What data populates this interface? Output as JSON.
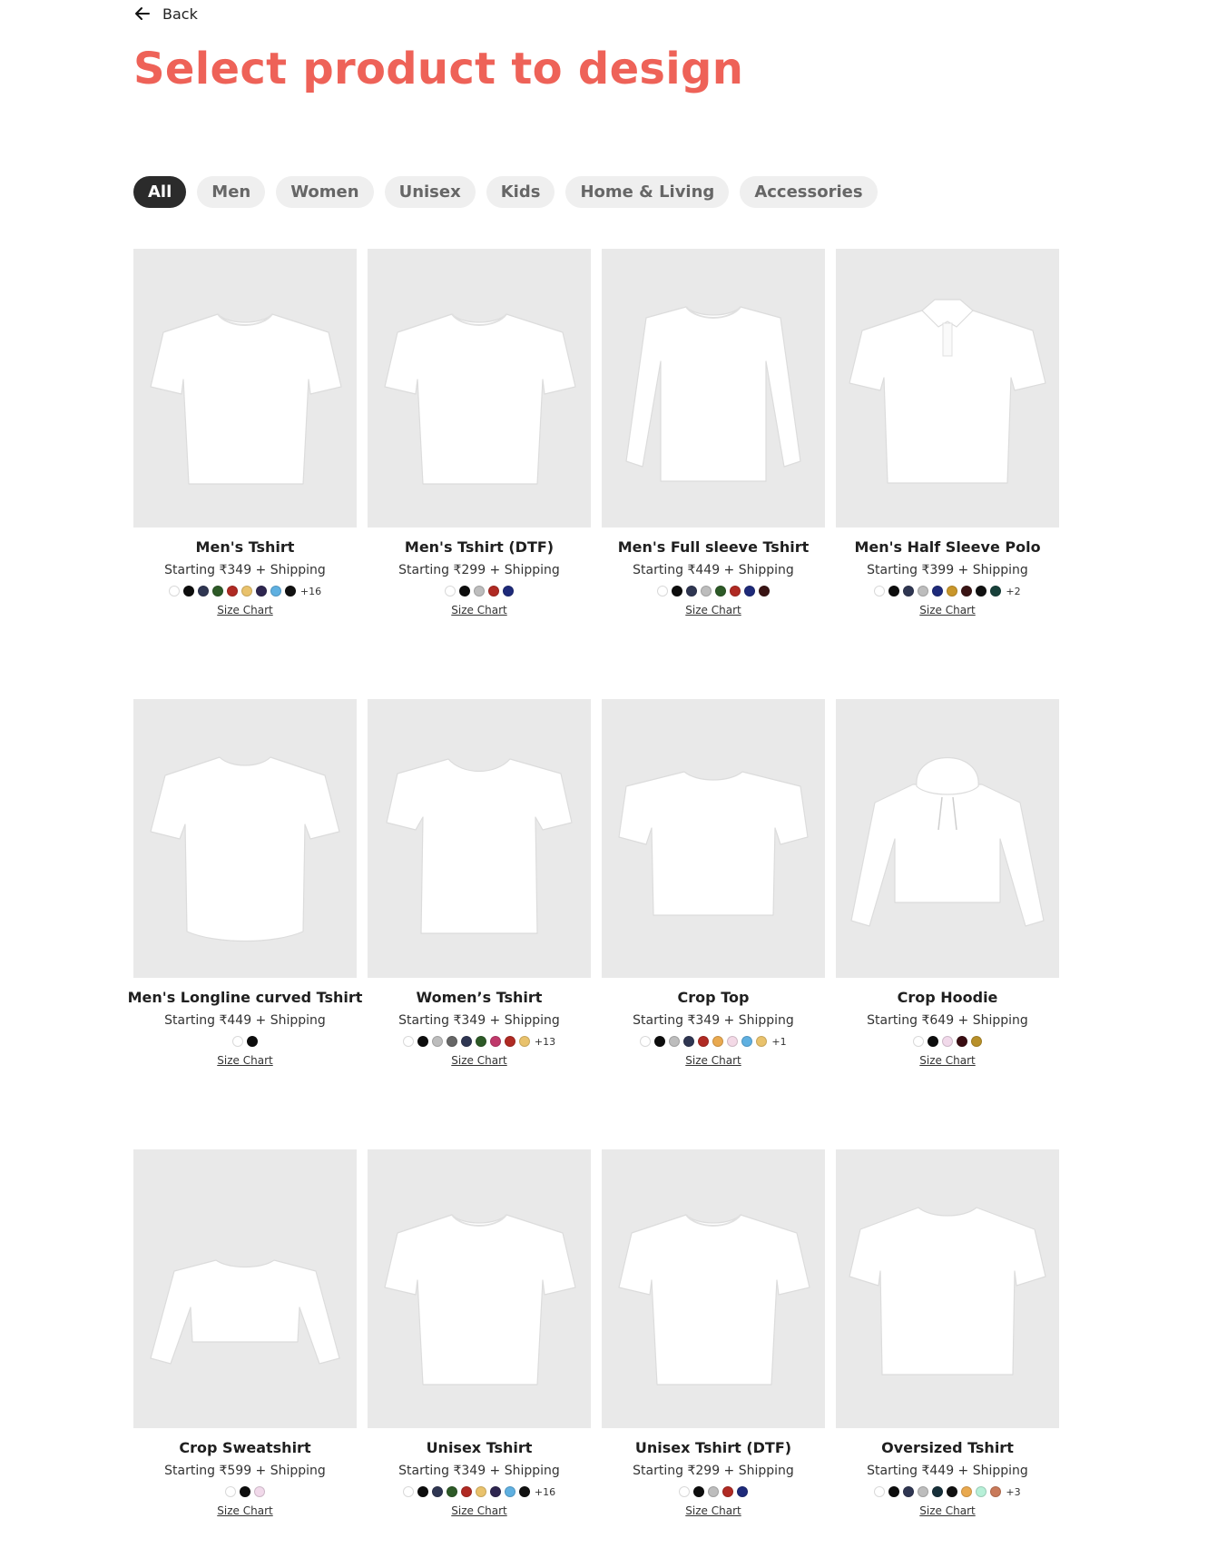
{
  "header": {
    "back_label": "Back",
    "title": "Select product to design"
  },
  "categories": [
    "All",
    "Men",
    "Women",
    "Unisex",
    "Kids",
    "Home & Living",
    "Accessories"
  ],
  "active_category": "All",
  "colors": {
    "title": "#ee6258",
    "chip_active": "#2b2b2b",
    "chip_bg": "#efefef",
    "thumb_bg": "#e9e9e9"
  },
  "products": [
    {
      "name": "Men's Tshirt",
      "price": "Starting ₹349 + Shipping",
      "shape": "tshirt",
      "swatches": [
        "#ffffff",
        "#0d0d0d",
        "#2f3652",
        "#2d5a27",
        "#b02a23",
        "#e9c26c",
        "#2e2650",
        "#5fb0e1",
        "#111111"
      ],
      "more": "+16",
      "size_chart": "Size Chart"
    },
    {
      "name": "Men's Tshirt (DTF)",
      "price": "Starting ₹299 + Shipping",
      "shape": "tshirt",
      "swatches": [
        "#ffffff",
        "#0d0d0d",
        "#bdbdbd",
        "#b02a23",
        "#1e2a7a"
      ],
      "more": "",
      "size_chart": "Size Chart"
    },
    {
      "name": "Men's Full sleeve Tshirt",
      "price": "Starting ₹449 + Shipping",
      "shape": "longsleeve",
      "swatches": [
        "#ffffff",
        "#0d0d0d",
        "#2f3652",
        "#bdbdbd",
        "#2d5a27",
        "#b02a23",
        "#1e2a7a",
        "#3a1414"
      ],
      "more": "",
      "size_chart": "Size Chart"
    },
    {
      "name": "Men's Half Sleeve Polo",
      "price": "Starting ₹399 + Shipping",
      "shape": "polo",
      "swatches": [
        "#ffffff",
        "#0d0d0d",
        "#2f3652",
        "#bdbdbd",
        "#1e2a7a",
        "#c9962a",
        "#3a1414",
        "#111111",
        "#17403a"
      ],
      "more": "+2",
      "size_chart": "Size Chart"
    },
    {
      "name": "Men's Longline curved Tshirt",
      "price": "Starting ₹449 + Shipping",
      "shape": "longline",
      "swatches": [
        "#ffffff",
        "#0d0d0d"
      ],
      "more": "",
      "size_chart": "Size Chart"
    },
    {
      "name": "Women’s Tshirt",
      "price": "Starting ₹349 + Shipping",
      "shape": "womens",
      "swatches": [
        "#ffffff",
        "#0d0d0d",
        "#bdbdbd",
        "#666666",
        "#2f3652",
        "#2d5a27",
        "#c0396b",
        "#b02a23",
        "#e9c26c"
      ],
      "more": "+13",
      "size_chart": "Size Chart"
    },
    {
      "name": "Crop Top",
      "price": "Starting ₹349 + Shipping",
      "shape": "croptop",
      "swatches": [
        "#ffffff",
        "#0d0d0d",
        "#bdbdbd",
        "#2f3652",
        "#b02a23",
        "#e9a94f",
        "#f3d9e6",
        "#5fb0e1",
        "#e9c26c"
      ],
      "more": "+1",
      "size_chart": "Size Chart"
    },
    {
      "name": "Crop Hoodie",
      "price": "Starting ₹649 + Shipping",
      "shape": "hoodie",
      "swatches": [
        "#ffffff",
        "#0d0d0d",
        "#f1d9ea",
        "#3a0d12",
        "#b8902a"
      ],
      "more": "",
      "size_chart": "Size Chart"
    },
    {
      "name": "Crop Sweatshirt",
      "price": "Starting ₹599 + Shipping",
      "shape": "sweatshirt",
      "swatches": [
        "#ffffff",
        "#0d0d0d",
        "#f1d9ea"
      ],
      "more": "",
      "size_chart": "Size Chart"
    },
    {
      "name": "Unisex Tshirt",
      "price": "Starting ₹349 + Shipping",
      "shape": "tshirt",
      "swatches": [
        "#ffffff",
        "#0d0d0d",
        "#2f3652",
        "#2d5a27",
        "#b02a23",
        "#e9c26c",
        "#2e2650",
        "#5fb0e1",
        "#111111"
      ],
      "more": "+16",
      "size_chart": "Size Chart"
    },
    {
      "name": "Unisex Tshirt (DTF)",
      "price": "Starting ₹299 + Shipping",
      "shape": "tshirt",
      "swatches": [
        "#ffffff",
        "#0d0d0d",
        "#bdbdbd",
        "#b02a23",
        "#1e2a7a"
      ],
      "more": "",
      "size_chart": "Size Chart"
    },
    {
      "name": "Oversized Tshirt",
      "price": "Starting ₹449 + Shipping",
      "shape": "oversized",
      "swatches": [
        "#ffffff",
        "#0d0d0d",
        "#2f3652",
        "#bdbdbd",
        "#17303a",
        "#111111",
        "#e9a94f",
        "#b7f0d8",
        "#c97a5a"
      ],
      "more": "+3",
      "size_chart": "Size Chart"
    }
  ]
}
